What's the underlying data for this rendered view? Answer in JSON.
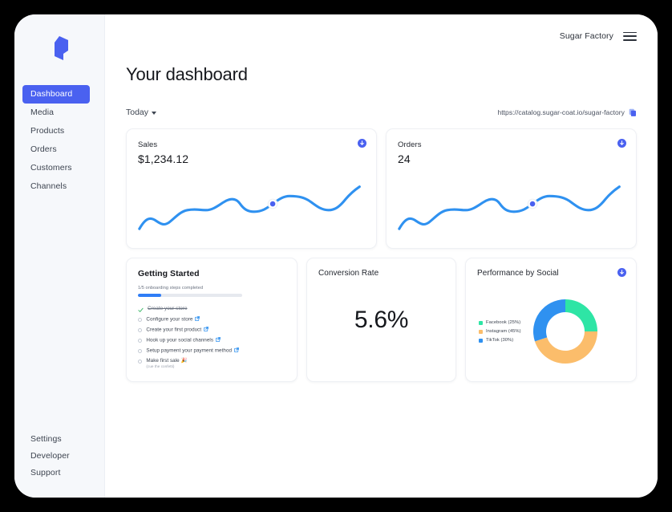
{
  "brand": {
    "logo_name": "cube-logo",
    "accent": "#4a61f0",
    "chart_blue": "#2f91f0"
  },
  "sidebar": {
    "primary_items": [
      {
        "label": "Dashboard",
        "active": true
      },
      {
        "label": "Media",
        "active": false
      },
      {
        "label": "Products",
        "active": false
      },
      {
        "label": "Orders",
        "active": false
      },
      {
        "label": "Customers",
        "active": false
      },
      {
        "label": "Channels",
        "active": false
      }
    ],
    "footer_items": [
      {
        "label": "Settings"
      },
      {
        "label": "Developer"
      },
      {
        "label": "Support"
      }
    ]
  },
  "topbar": {
    "store_name": "Sugar Factory",
    "menu_icon": "hamburger-menu-icon"
  },
  "header": {
    "title": "Your dashboard"
  },
  "subbar": {
    "range_label": "Today",
    "store_url": "https://catalog.sugar-coat.io/sugar-factory",
    "copy_icon": "copy-icon"
  },
  "stats": [
    {
      "label": "Sales",
      "value": "$1,234.12",
      "download_icon": "download-circle-icon"
    },
    {
      "label": "Orders",
      "value": "24",
      "download_icon": "download-circle-icon"
    }
  ],
  "getting_started": {
    "title": "Getting Started",
    "progress_label": "1/5 onboarding steps completed",
    "progress_percent": 22,
    "steps": [
      {
        "text": "Create your store",
        "done": true,
        "external": false
      },
      {
        "text": "Configure your store",
        "done": false,
        "external": true
      },
      {
        "text": "Create your first product",
        "done": false,
        "external": true
      },
      {
        "text": "Hook up your social channels",
        "done": false,
        "external": true
      },
      {
        "text": "Setup payment your payment method",
        "done": false,
        "external": true
      },
      {
        "text": "Make first sale 🎉",
        "sub": "(cue the confetti)",
        "done": false,
        "external": false
      }
    ]
  },
  "conversion": {
    "title": "Conversion Rate",
    "value": "5.6%"
  },
  "chart_data": {
    "type": "pie",
    "title": "Performance by Social",
    "legend_position": "left",
    "categories": [
      "Facebook",
      "Instagram",
      "TikTok"
    ],
    "values": [
      25,
      45,
      30
    ],
    "labels": [
      "Facebook (25%)",
      "Instagram (45%)",
      "TikTok (30%)"
    ],
    "colors": [
      "#2ee5a5",
      "#fbbd6b",
      "#2f91f0"
    ],
    "download_icon": "download-circle-icon"
  },
  "sparklines": {
    "type": "line",
    "series": [
      {
        "name": "Sales",
        "values": [
          8,
          22,
          14,
          20,
          40,
          37,
          48,
          43,
          38,
          52,
          68,
          62,
          55,
          58,
          72
        ]
      },
      {
        "name": "Orders",
        "values": [
          8,
          22,
          14,
          20,
          40,
          37,
          48,
          43,
          38,
          52,
          68,
          62,
          55,
          58,
          72
        ]
      }
    ],
    "marker_color": "#4a61f0",
    "line_color": "#2f91f0"
  }
}
